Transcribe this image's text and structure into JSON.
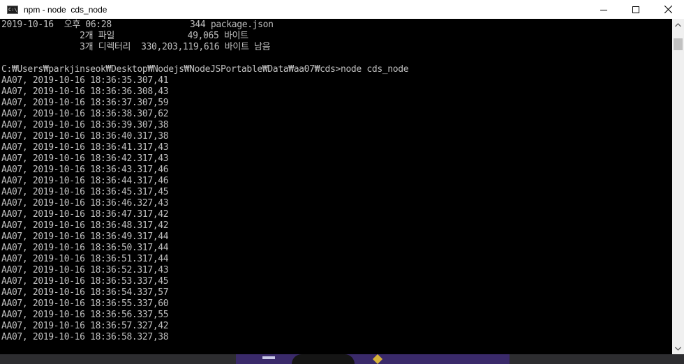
{
  "window": {
    "title": "npm - node  cds_node",
    "app_icon_text": "C:\\",
    "controls": [
      "minimize",
      "maximize",
      "close"
    ]
  },
  "console": {
    "lines": [
      "2019-10-16  오후 06:28               344 package.json",
      "               2개 파일              49,065 바이트",
      "               3개 디렉터리  330,203,119,616 바이트 남음",
      "",
      "C:₩Users₩parkjinseok₩Desktop₩Nodejs₩NodeJSPortable₩Data₩aa07₩cds>node cds_node",
      "AA07, 2019-10-16 18:36:35.307,41",
      "AA07, 2019-10-16 18:36:36.308,43",
      "AA07, 2019-10-16 18:36:37.307,59",
      "AA07, 2019-10-16 18:36:38.307,62",
      "AA07, 2019-10-16 18:36:39.307,38",
      "AA07, 2019-10-16 18:36:40.317,38",
      "AA07, 2019-10-16 18:36:41.317,43",
      "AA07, 2019-10-16 18:36:42.317,43",
      "AA07, 2019-10-16 18:36:43.317,46",
      "AA07, 2019-10-16 18:36:44.317,46",
      "AA07, 2019-10-16 18:36:45.317,45",
      "AA07, 2019-10-16 18:36:46.327,43",
      "AA07, 2019-10-16 18:36:47.317,42",
      "AA07, 2019-10-16 18:36:48.317,42",
      "AA07, 2019-10-16 18:36:49.317,44",
      "AA07, 2019-10-16 18:36:50.317,44",
      "AA07, 2019-10-16 18:36:51.317,44",
      "AA07, 2019-10-16 18:36:52.317,43",
      "AA07, 2019-10-16 18:36:53.337,45",
      "AA07, 2019-10-16 18:36:54.337,57",
      "AA07, 2019-10-16 18:36:55.337,60",
      "AA07, 2019-10-16 18:36:56.337,55",
      "AA07, 2019-10-16 18:36:57.327,42",
      "AA07, 2019-10-16 18:36:58.327,38"
    ]
  },
  "colors": {
    "console_bg": "#000000",
    "console_text": "#c0c0c0",
    "titlebar_bg": "#ffffff"
  },
  "icons": {
    "app": "console-icon",
    "minimize": "minimize-icon",
    "maximize": "maximize-icon",
    "close": "close-icon",
    "scroll_up": "scroll-up-arrow-icon",
    "scroll_down": "scroll-down-arrow-icon"
  }
}
